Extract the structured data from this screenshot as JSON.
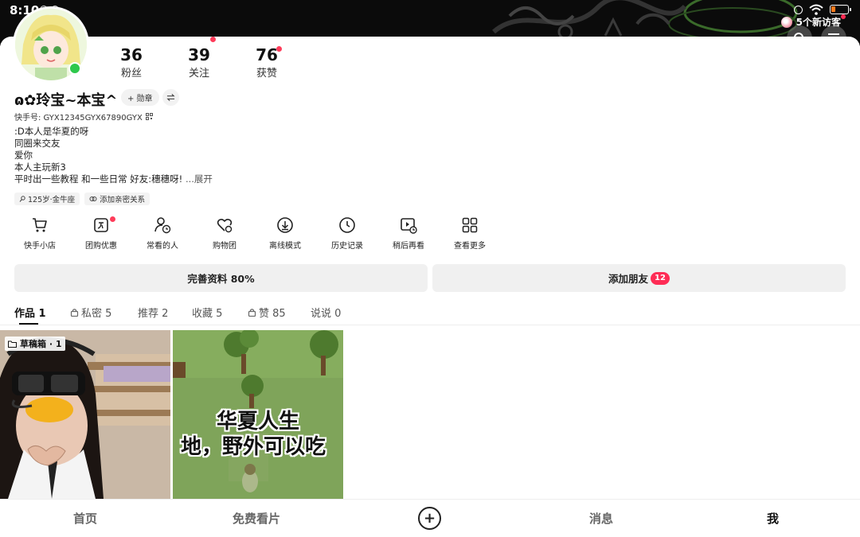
{
  "status_bar": {
    "time": "8:10"
  },
  "visitor": {
    "label": "5个新访客"
  },
  "profile": {
    "nickname": "ɷ✿玲宝~本宝^",
    "badge_label": "+ 勋章",
    "kuaishou_id": "快手号: GYX12345GYX67890GYX",
    "bio_lines": [
      ":D本人是华夏的呀",
      "同圈来交友",
      "爱你",
      "本人主玩新3",
      "平时出一些教程 和一些日常 好友:穗穗呀!"
    ],
    "bio_more": "...展开",
    "tags": [
      "125岁·金牛座",
      "添加亲密关系"
    ]
  },
  "stats": [
    {
      "value": "36",
      "label": "粉丝"
    },
    {
      "value": "39",
      "label": "关注"
    },
    {
      "value": "76",
      "label": "获赞"
    }
  ],
  "tools": [
    {
      "label": "快手小店",
      "icon": "cart-icon"
    },
    {
      "label": "团购优惠",
      "icon": "coupon-icon"
    },
    {
      "label": "常看的人",
      "icon": "person-clock-icon"
    },
    {
      "label": "购物团",
      "icon": "heart-cart-icon"
    },
    {
      "label": "离线模式",
      "icon": "download-cloud-icon"
    },
    {
      "label": "历史记录",
      "icon": "clock-icon"
    },
    {
      "label": "稍后再看",
      "icon": "play-later-icon"
    },
    {
      "label": "查看更多",
      "icon": "grid-icon"
    }
  ],
  "actions": {
    "complete_profile": "完善资料 80%",
    "add_friend": "添加朋友",
    "add_friend_count": "12"
  },
  "tabs": [
    {
      "label": "作品 1",
      "locked": false
    },
    {
      "label": "私密 5",
      "locked": true
    },
    {
      "label": "推荐 2",
      "locked": false
    },
    {
      "label": "收藏 5",
      "locked": false
    },
    {
      "label": "赞 85",
      "locked": true
    },
    {
      "label": "说说 0",
      "locked": false
    }
  ],
  "grid": {
    "draft_label": "草稿箱 · 1",
    "tile2_text_line1": "华夏人生",
    "tile2_text_line2": "地，野外可以吃"
  },
  "bottom_nav": [
    {
      "label": "首页"
    },
    {
      "label": "免费看片"
    },
    {
      "label": "消息"
    },
    {
      "label": "我"
    }
  ],
  "colors": {
    "accent_red": "#fe2c55",
    "online_green": "#2ec84c",
    "banner_bg": "#0b0b0b"
  }
}
